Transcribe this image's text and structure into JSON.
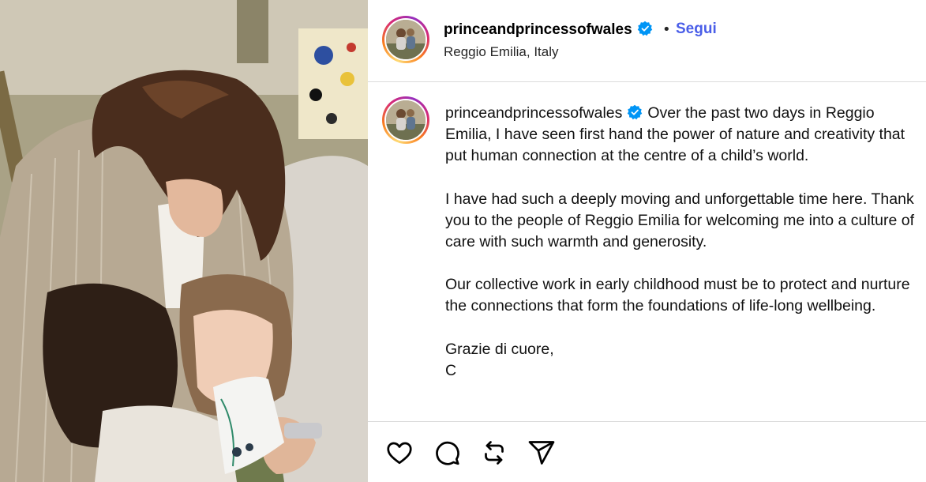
{
  "post": {
    "username": "princeandprincessofwales",
    "verified": true,
    "separator": "•",
    "follow_label": "Segui",
    "location": "Reggio Emilia, Italy"
  },
  "caption": {
    "username": "princeandprincessofwales",
    "paragraphs": [
      "Over the past two days in Reggio Emilia, I have seen first hand the power of nature and creativity that put human connection at the centre of a child’s world.",
      "I have had such a deeply moving and unforgettable time here. Thank you to the people of Reggio Emilia for welcoming me into a culture of care with such warmth and generosity.",
      "Our collective work in early childhood must be to protect and nurture the connections that form the foundations of life-long wellbeing.",
      "Grazie di cuore,",
      "C"
    ]
  },
  "actions": {
    "icons": [
      "heart-icon",
      "comment-icon",
      "repost-icon",
      "share-icon"
    ]
  },
  "colors": {
    "follow_blue": "#4a5ee8",
    "verified_blue": "#0095f6",
    "divider": "#dbdbdb"
  }
}
